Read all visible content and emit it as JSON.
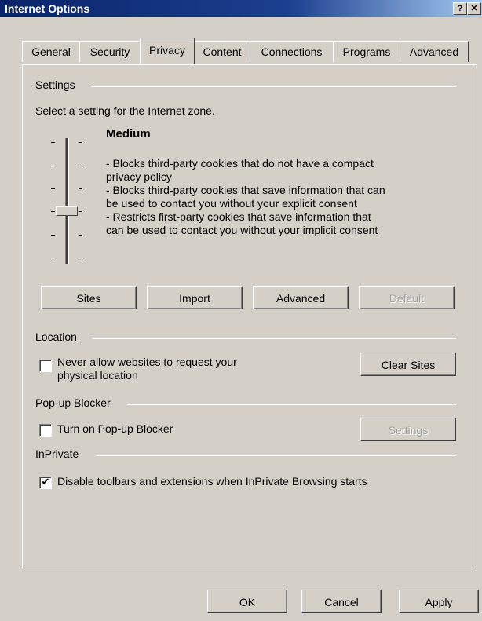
{
  "window": {
    "title": "Internet Options",
    "help_label": "?",
    "close_label": "✕"
  },
  "tabs": [
    {
      "label": "General"
    },
    {
      "label": "Security"
    },
    {
      "label": "Privacy",
      "active": true
    },
    {
      "label": "Content"
    },
    {
      "label": "Connections"
    },
    {
      "label": "Programs"
    },
    {
      "label": "Advanced"
    }
  ],
  "settings": {
    "section_label": "Settings",
    "instruction": "Select a setting for the Internet zone.",
    "level_name": "Medium",
    "description": [
      "- Blocks third-party cookies that do not have a compact",
      "privacy policy",
      "- Blocks third-party cookies that save information that can",
      "be used to contact you without your explicit consent",
      "- Restricts first-party cookies that save information that",
      "can be used to contact you without your implicit consent"
    ],
    "slider_level": 3,
    "buttons": {
      "sites": "Sites",
      "import": "Import",
      "advanced": "Advanced",
      "default": "Default"
    }
  },
  "location": {
    "section_label": "Location",
    "checkbox_label_line1": "Never allow websites to request your",
    "checkbox_label_line2": "physical location",
    "checked": false,
    "clear_sites": "Clear Sites"
  },
  "popup": {
    "section_label": "Pop-up Blocker",
    "checkbox_label": "Turn on Pop-up Blocker",
    "checked": false,
    "settings": "Settings"
  },
  "inprivate": {
    "section_label": "InPrivate",
    "checkbox_label": "Disable toolbars and extensions when InPrivate Browsing starts",
    "checked": true,
    "check_glyph": "✔"
  },
  "footer": {
    "ok": "OK",
    "cancel": "Cancel",
    "apply": "Apply"
  }
}
